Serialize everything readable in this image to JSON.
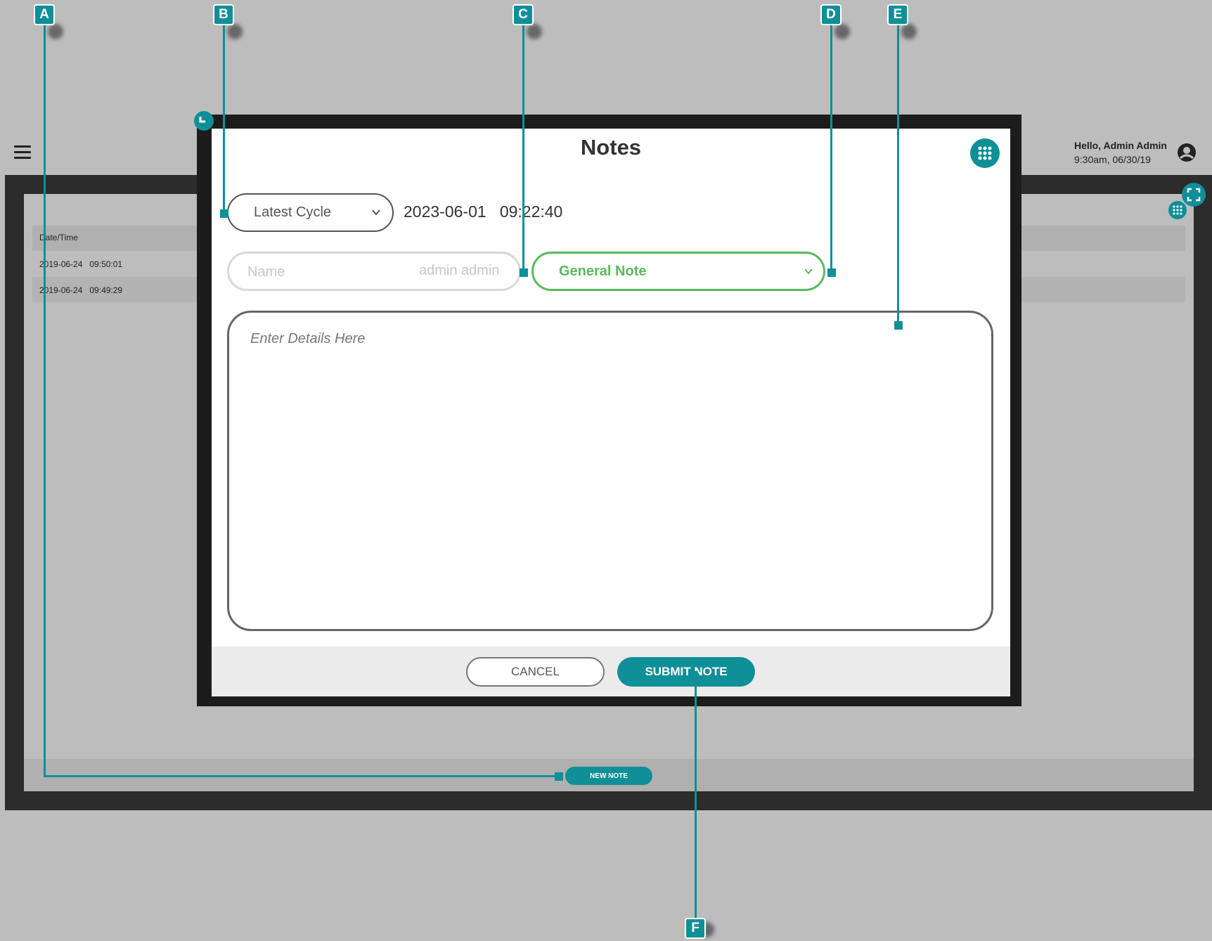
{
  "background_app": {
    "greeting": "Hello, Admin Admin",
    "greeting_sub": "9:30am, 06/30/19",
    "table": {
      "header": "Date/Time",
      "rows": [
        "2019-06-24   09:50:01",
        "2019-06-24   09:49:29"
      ]
    },
    "new_note_label": "NEW NOTE"
  },
  "modal": {
    "title": "Notes",
    "cycle_select": "Latest Cycle",
    "cycle_datetime": "2023-06-01   09:22:40",
    "name_label": "Name",
    "name_value": "admin admin",
    "note_type": "General Note",
    "details_placeholder": "Enter Details Here",
    "cancel_label": "CANCEL",
    "submit_label": "SUBMIT NOTE"
  },
  "callouts": [
    "A",
    "B",
    "C",
    "D",
    "E",
    "F"
  ],
  "colors": {
    "accent": "#0f8f98",
    "note_type": "#5cb85c",
    "shell": "#1c1c1c"
  },
  "icons": [
    "hamburger-icon",
    "account-icon",
    "fullscreen-icon",
    "grid-icon",
    "chevron-down-icon",
    "corner-icon"
  ]
}
